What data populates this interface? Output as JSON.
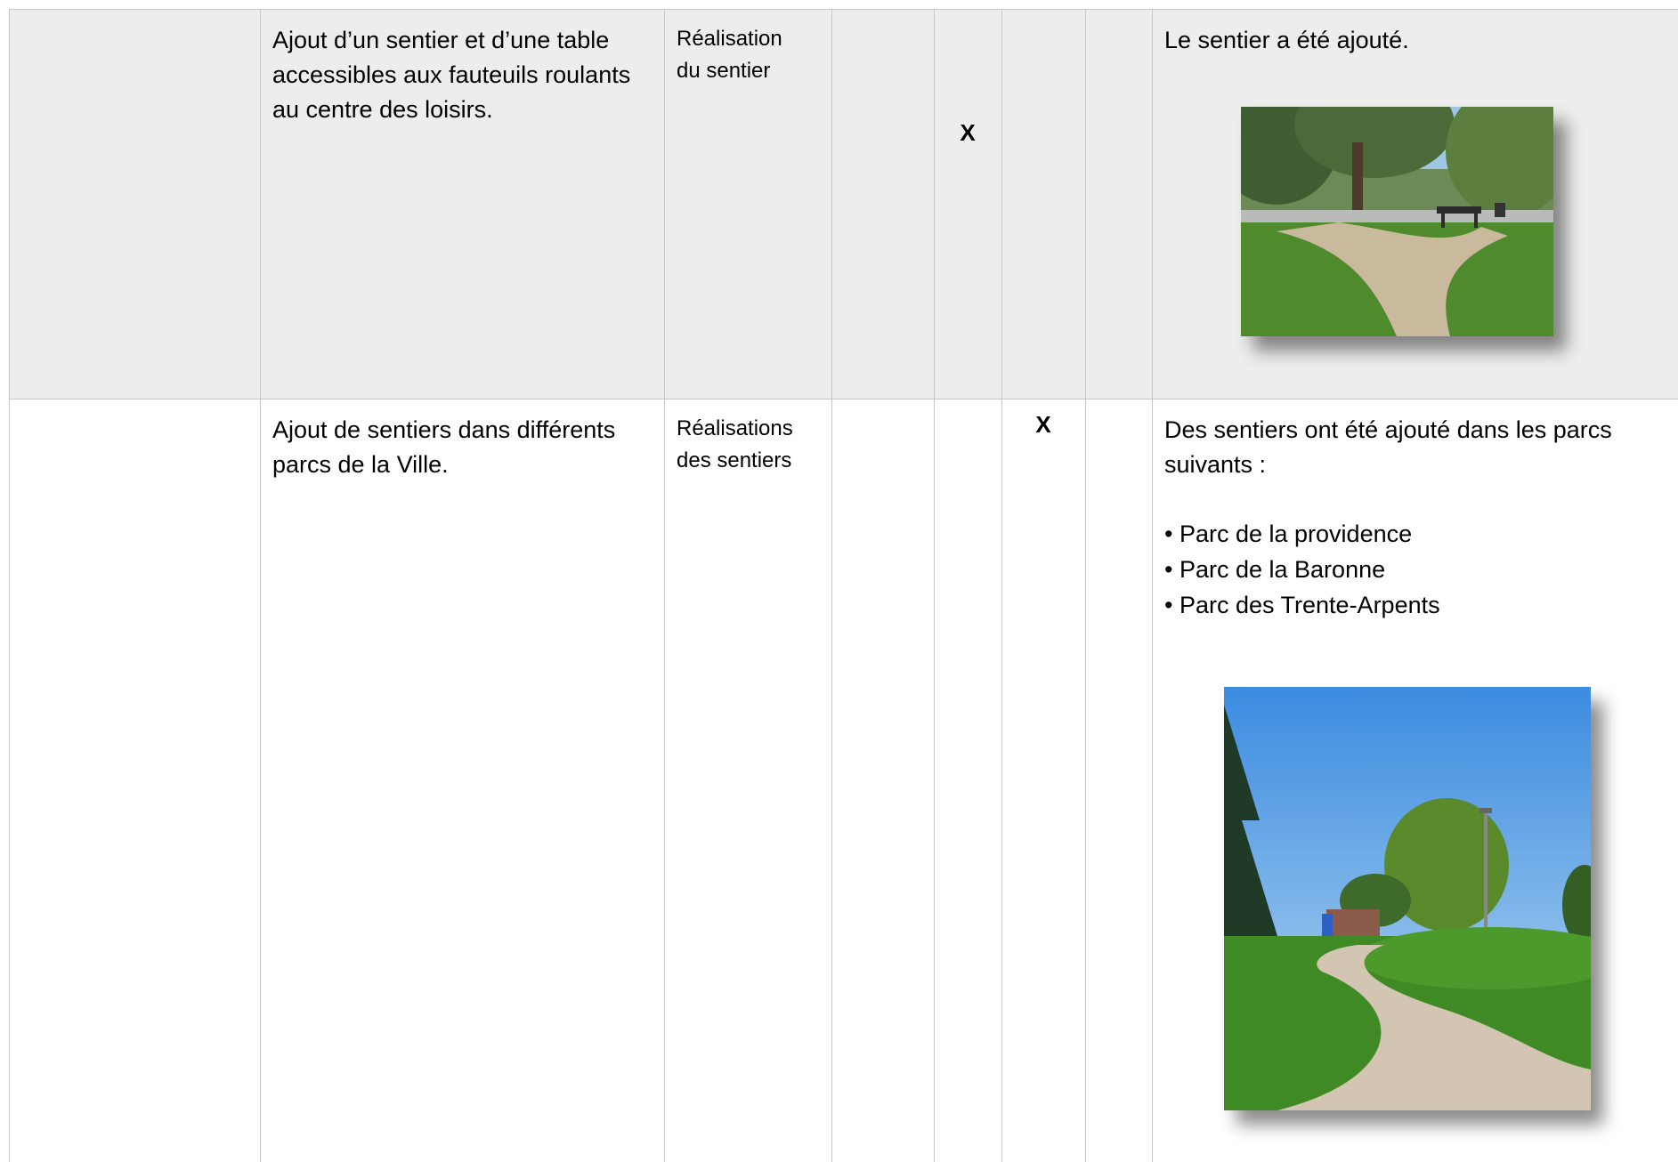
{
  "rows": [
    {
      "action": "Ajout d’un sentier et d’une table accessibles aux fauteuils roulants au centre des loisirs.",
      "indicator": "Réalisation du sentier",
      "status_mark": "X",
      "result_text": "Le sentier a été ajouté."
    },
    {
      "action": "Ajout de sentiers dans différents parcs de la Ville.",
      "indicator": "Réalisations des sentiers",
      "status_mark": "X",
      "result_text": "Des sentiers ont été ajouté dans les parcs suivants :",
      "parks": [
        "Parc de la providence",
        "Parc de la Baronne",
        "Parc des Trente-Arpents"
      ]
    }
  ],
  "colors": {
    "row_shaded": "#ededed",
    "grid_line": "#c9c9c9"
  }
}
